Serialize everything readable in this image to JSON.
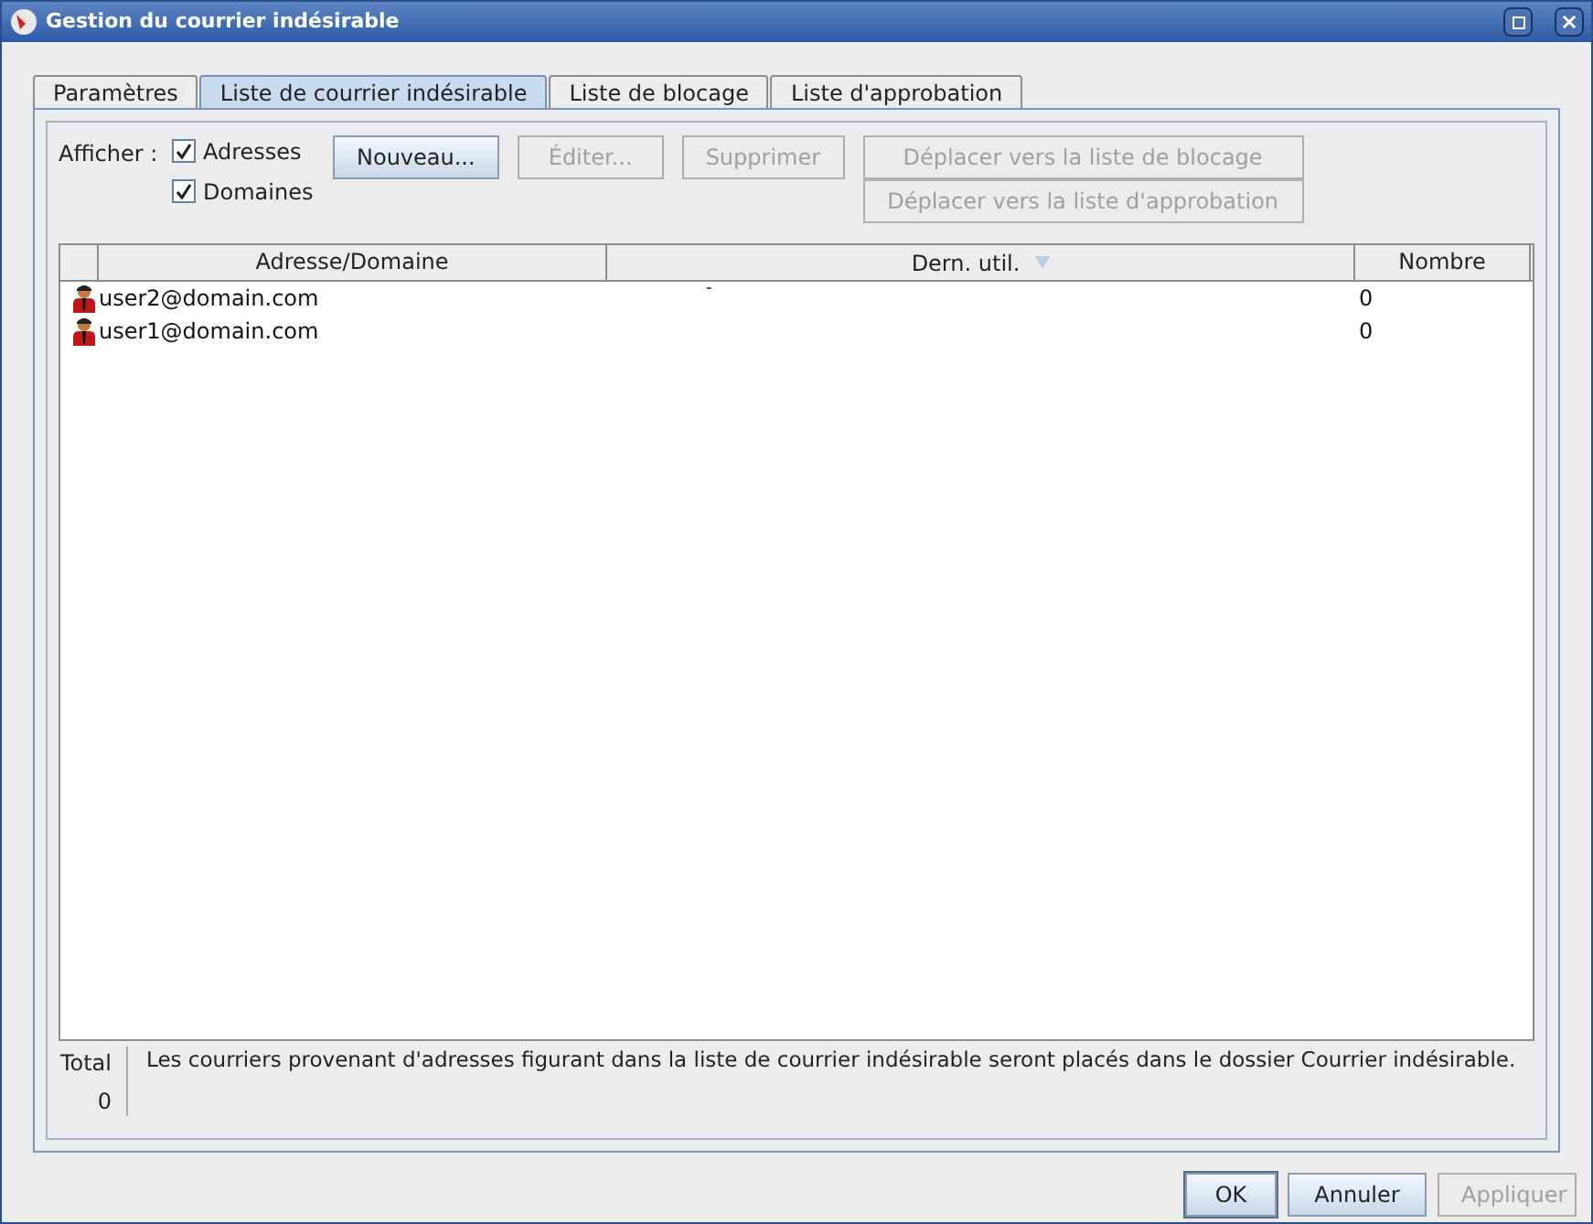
{
  "window": {
    "title": "Gestion du courrier indésirable"
  },
  "tabs": [
    {
      "label": "Paramètres",
      "selected": false
    },
    {
      "label": "Liste de courrier indésirable",
      "selected": true
    },
    {
      "label": "Liste de blocage",
      "selected": false
    },
    {
      "label": "Liste d'approbation",
      "selected": false
    }
  ],
  "show": {
    "label": "Afficher :",
    "options": [
      {
        "label": "Adresses",
        "checked": true
      },
      {
        "label": "Domaines",
        "checked": true
      }
    ]
  },
  "actions": [
    {
      "label": "Nouveau...",
      "disabled": false
    },
    {
      "label": "Éditer...",
      "disabled": true
    },
    {
      "label": "Supprimer",
      "disabled": true
    }
  ],
  "move_actions": [
    {
      "label": "Déplacer vers la liste de blocage",
      "disabled": true
    },
    {
      "label": "Déplacer vers la liste d'approbation",
      "disabled": true
    }
  ],
  "table": {
    "columns": [
      "Adresse/Domaine",
      "Dern. util.",
      "Nombre"
    ],
    "rows": [
      {
        "address": "user2@domain.com",
        "last_used": "-",
        "count": "0"
      },
      {
        "address": "user1@domain.com",
        "count": "0"
      }
    ]
  },
  "footer": {
    "total_label": "Total",
    "total": "0",
    "info": "Les courriers provenant d'adresses figurant dans la liste de courrier indésirable seront placés dans le dossier Courrier indésirable."
  },
  "buttons": [
    {
      "label": "OK",
      "disabled": false,
      "default": true
    },
    {
      "label": "Annuler",
      "disabled": false,
      "default": false
    },
    {
      "label": "Appliquer",
      "disabled": true,
      "default": false
    }
  ]
}
